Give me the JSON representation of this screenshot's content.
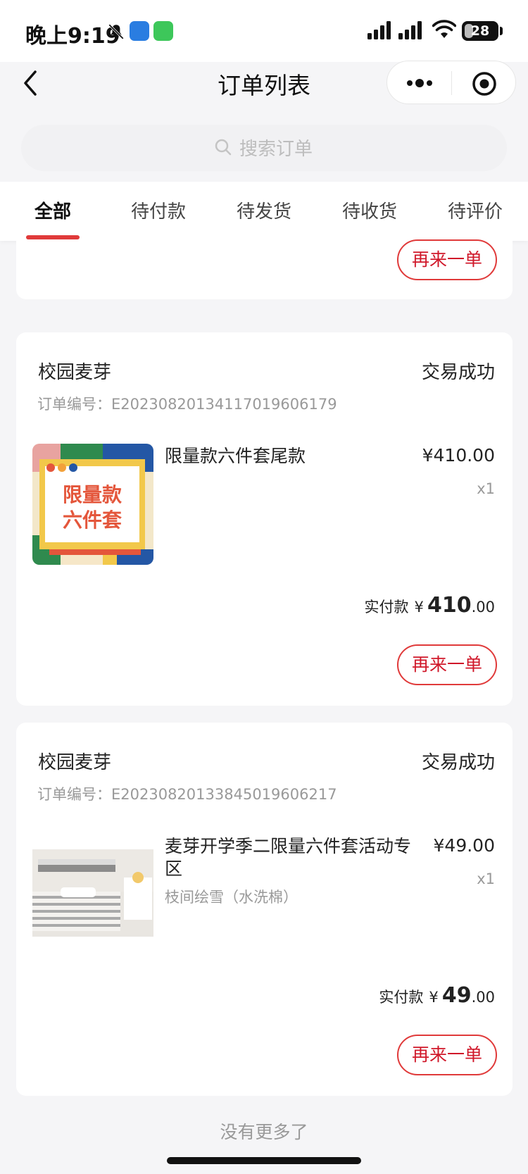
{
  "status_bar": {
    "time": "晚上9:19",
    "battery": "28",
    "battery_level": 0.28
  },
  "nav": {
    "title": "订单列表"
  },
  "search": {
    "placeholder": "搜索订单"
  },
  "tabs": [
    "全部",
    "待付款",
    "待发货",
    "待收货",
    "待评价"
  ],
  "active_tab": 0,
  "orders": [
    {
      "shop": "校园麦芽",
      "status": "交易成功",
      "order_no": "订单编号：E20230820134117019606179",
      "product_name": "限量款六件套尾款",
      "product_image_text": "限量款六件套",
      "variant": "",
      "price": "¥410.00",
      "qty": "x1",
      "paid_label": "实付款",
      "paid_yen": "¥",
      "paid_int": "410",
      "paid_dec": ".00",
      "reorder": "再来一单"
    },
    {
      "shop": "校园麦芽",
      "status": "交易成功",
      "order_no": "订单编号：E20230820133845019606217",
      "product_name": "麦芽开学季二限量六件套活动专区",
      "variant": "枝间绘雪（水洗棉）",
      "price": "¥49.00",
      "qty": "x1",
      "paid_label": "实付款",
      "paid_yen": "¥",
      "paid_int": "49",
      "paid_dec": ".00",
      "reorder": "再来一单"
    }
  ],
  "top_card": {
    "reorder": "再来一单"
  },
  "footer": {
    "no_more": "没有更多了"
  },
  "colors": {
    "accent": "#e03a3a",
    "page_bg": "#f5f5f7"
  }
}
